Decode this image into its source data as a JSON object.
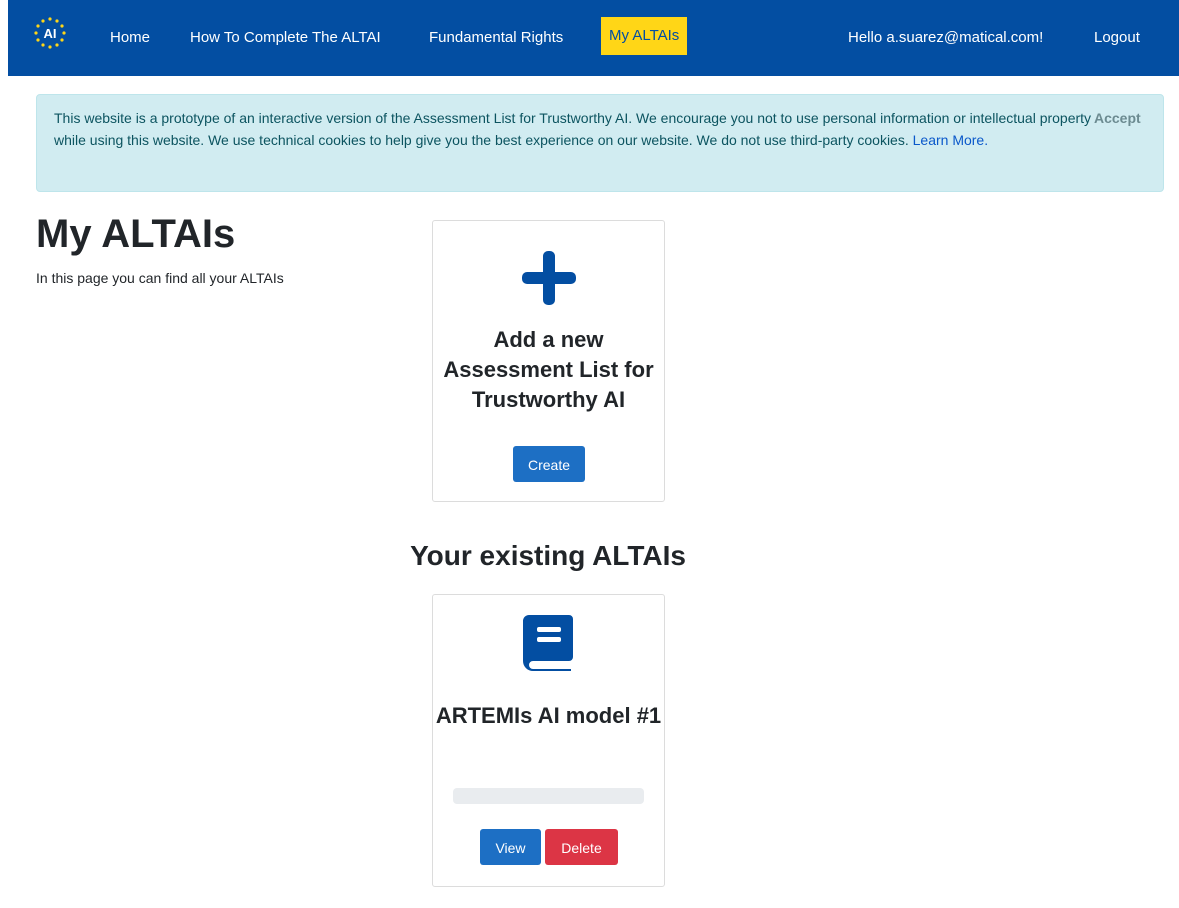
{
  "nav": {
    "brand_text": "AI",
    "links": [
      "Home",
      "How To Complete The ALTAI",
      "Fundamental Rights",
      "My ALTAIs"
    ],
    "active_index": 3,
    "greeting": "Hello a.suarez@matical.com!",
    "logout": "Logout"
  },
  "cookie_notice": {
    "text": "This website is a prototype of an interactive version of the Assessment List for Trustworthy AI. We encourage you not to use personal information or intellectual property while using this website. We use technical cookies to help give you the best experience on our website. We do not use third-party cookies.",
    "link": "Learn More.",
    "accept": "Accept"
  },
  "page": {
    "title": "My ALTAIs",
    "subtitle": "In this page you can find all your ALTAIs"
  },
  "new_card": {
    "icon": "plus-icon",
    "title": "Add a new Assessment List for Trustworthy AI",
    "button": "Create"
  },
  "existing_section": {
    "title": "Your existing ALTAIs"
  },
  "existing_items": [
    {
      "icon": "book-icon",
      "title": "ARTEMIs AI model #1",
      "progress": 0,
      "view": "View",
      "delete": "Delete"
    }
  ],
  "colors": {
    "nav_bg": "#034ea2",
    "active_bg": "#ffd617",
    "accent": "#034ea2",
    "primary_button": "#1d6fc4",
    "danger_button": "#dc3545",
    "notice_bg": "#d1ecf1"
  }
}
